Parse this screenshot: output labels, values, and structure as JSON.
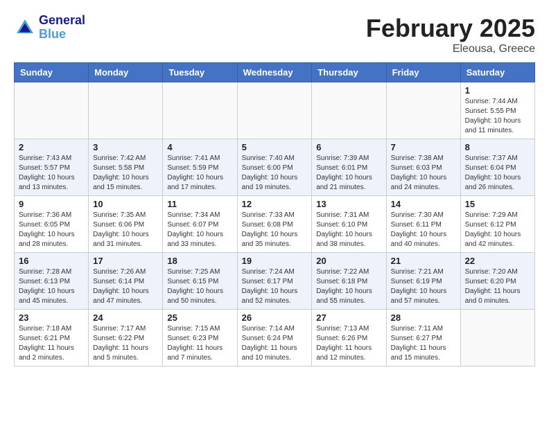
{
  "header": {
    "logo_line1": "General",
    "logo_line2": "Blue",
    "title": "February 2025",
    "subtitle": "Eleousa, Greece"
  },
  "days_of_week": [
    "Sunday",
    "Monday",
    "Tuesday",
    "Wednesday",
    "Thursday",
    "Friday",
    "Saturday"
  ],
  "weeks": [
    [
      {
        "day": "",
        "info": ""
      },
      {
        "day": "",
        "info": ""
      },
      {
        "day": "",
        "info": ""
      },
      {
        "day": "",
        "info": ""
      },
      {
        "day": "",
        "info": ""
      },
      {
        "day": "",
        "info": ""
      },
      {
        "day": "1",
        "info": "Sunrise: 7:44 AM\nSunset: 5:55 PM\nDaylight: 10 hours and 11 minutes."
      }
    ],
    [
      {
        "day": "2",
        "info": "Sunrise: 7:43 AM\nSunset: 5:57 PM\nDaylight: 10 hours and 13 minutes."
      },
      {
        "day": "3",
        "info": "Sunrise: 7:42 AM\nSunset: 5:58 PM\nDaylight: 10 hours and 15 minutes."
      },
      {
        "day": "4",
        "info": "Sunrise: 7:41 AM\nSunset: 5:59 PM\nDaylight: 10 hours and 17 minutes."
      },
      {
        "day": "5",
        "info": "Sunrise: 7:40 AM\nSunset: 6:00 PM\nDaylight: 10 hours and 19 minutes."
      },
      {
        "day": "6",
        "info": "Sunrise: 7:39 AM\nSunset: 6:01 PM\nDaylight: 10 hours and 21 minutes."
      },
      {
        "day": "7",
        "info": "Sunrise: 7:38 AM\nSunset: 6:03 PM\nDaylight: 10 hours and 24 minutes."
      },
      {
        "day": "8",
        "info": "Sunrise: 7:37 AM\nSunset: 6:04 PM\nDaylight: 10 hours and 26 minutes."
      }
    ],
    [
      {
        "day": "9",
        "info": "Sunrise: 7:36 AM\nSunset: 6:05 PM\nDaylight: 10 hours and 28 minutes."
      },
      {
        "day": "10",
        "info": "Sunrise: 7:35 AM\nSunset: 6:06 PM\nDaylight: 10 hours and 31 minutes."
      },
      {
        "day": "11",
        "info": "Sunrise: 7:34 AM\nSunset: 6:07 PM\nDaylight: 10 hours and 33 minutes."
      },
      {
        "day": "12",
        "info": "Sunrise: 7:33 AM\nSunset: 6:08 PM\nDaylight: 10 hours and 35 minutes."
      },
      {
        "day": "13",
        "info": "Sunrise: 7:31 AM\nSunset: 6:10 PM\nDaylight: 10 hours and 38 minutes."
      },
      {
        "day": "14",
        "info": "Sunrise: 7:30 AM\nSunset: 6:11 PM\nDaylight: 10 hours and 40 minutes."
      },
      {
        "day": "15",
        "info": "Sunrise: 7:29 AM\nSunset: 6:12 PM\nDaylight: 10 hours and 42 minutes."
      }
    ],
    [
      {
        "day": "16",
        "info": "Sunrise: 7:28 AM\nSunset: 6:13 PM\nDaylight: 10 hours and 45 minutes."
      },
      {
        "day": "17",
        "info": "Sunrise: 7:26 AM\nSunset: 6:14 PM\nDaylight: 10 hours and 47 minutes."
      },
      {
        "day": "18",
        "info": "Sunrise: 7:25 AM\nSunset: 6:15 PM\nDaylight: 10 hours and 50 minutes."
      },
      {
        "day": "19",
        "info": "Sunrise: 7:24 AM\nSunset: 6:17 PM\nDaylight: 10 hours and 52 minutes."
      },
      {
        "day": "20",
        "info": "Sunrise: 7:22 AM\nSunset: 6:18 PM\nDaylight: 10 hours and 55 minutes."
      },
      {
        "day": "21",
        "info": "Sunrise: 7:21 AM\nSunset: 6:19 PM\nDaylight: 10 hours and 57 minutes."
      },
      {
        "day": "22",
        "info": "Sunrise: 7:20 AM\nSunset: 6:20 PM\nDaylight: 11 hours and 0 minutes."
      }
    ],
    [
      {
        "day": "23",
        "info": "Sunrise: 7:18 AM\nSunset: 6:21 PM\nDaylight: 11 hours and 2 minutes."
      },
      {
        "day": "24",
        "info": "Sunrise: 7:17 AM\nSunset: 6:22 PM\nDaylight: 11 hours and 5 minutes."
      },
      {
        "day": "25",
        "info": "Sunrise: 7:15 AM\nSunset: 6:23 PM\nDaylight: 11 hours and 7 minutes."
      },
      {
        "day": "26",
        "info": "Sunrise: 7:14 AM\nSunset: 6:24 PM\nDaylight: 11 hours and 10 minutes."
      },
      {
        "day": "27",
        "info": "Sunrise: 7:13 AM\nSunset: 6:26 PM\nDaylight: 11 hours and 12 minutes."
      },
      {
        "day": "28",
        "info": "Sunrise: 7:11 AM\nSunset: 6:27 PM\nDaylight: 11 hours and 15 minutes."
      },
      {
        "day": "",
        "info": ""
      }
    ]
  ]
}
